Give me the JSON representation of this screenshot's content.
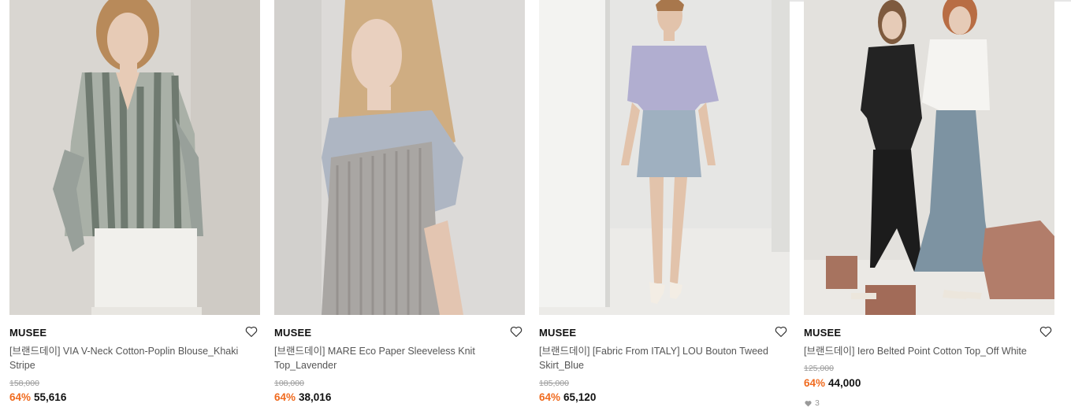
{
  "products": [
    {
      "brand": "MUSEE",
      "title": "[브랜드데이] VIA V-Neck Cotton-Poplin Blouse_Khaki Stripe",
      "original_price": "158,000",
      "discount": "64%",
      "price": "55,616",
      "photo_colors": {
        "bg": "#d9d6d1",
        "shade": "#c9c5bf",
        "top": "#8d958c",
        "bottom": "#f1f0ec",
        "skin": "#e7cbb6",
        "hair": "#b88a5a"
      }
    },
    {
      "brand": "MUSEE",
      "title": "[브랜드데이] MARE Eco Paper Sleeveless Knit Top_Lavender",
      "original_price": "108,000",
      "discount": "64%",
      "price": "38,016",
      "photo_colors": {
        "bg": "#dcdad8",
        "shade": "#cdcbc8",
        "top": "#aeb6c3",
        "bottom": "#a9a6a3",
        "skin": "#e9d0bf",
        "hair": "#cfad82"
      }
    },
    {
      "brand": "MUSEE",
      "title": "[브랜드데이] [Fabric From ITALY] LOU Bouton Tweed Skirt_Blue",
      "original_price": "185,000",
      "discount": "64%",
      "price": "65,120",
      "photo_colors": {
        "bg": "#e6e6e4",
        "shade": "#d5d5d2",
        "top": "#b1aed0",
        "bottom": "#9fb0c0",
        "skin": "#e2c3ab",
        "hair": "#a8774c"
      }
    },
    {
      "brand": "MUSEE",
      "title": "[브랜드데이] Iero Belted Point Cotton Top_Off White",
      "original_price": "125,000",
      "discount": "64%",
      "price": "44,000",
      "likes": "3",
      "photo_colors": {
        "bg": "#e3e1dd",
        "shade": "#d2cfca",
        "top": "#f5f4f1",
        "bottom": "#7d93a2",
        "skin": "#e6cbb7",
        "hair": "#b86d44"
      }
    }
  ],
  "icons": {
    "wishlist": "heart-outline-icon",
    "likes": "heart-filled-icon"
  }
}
